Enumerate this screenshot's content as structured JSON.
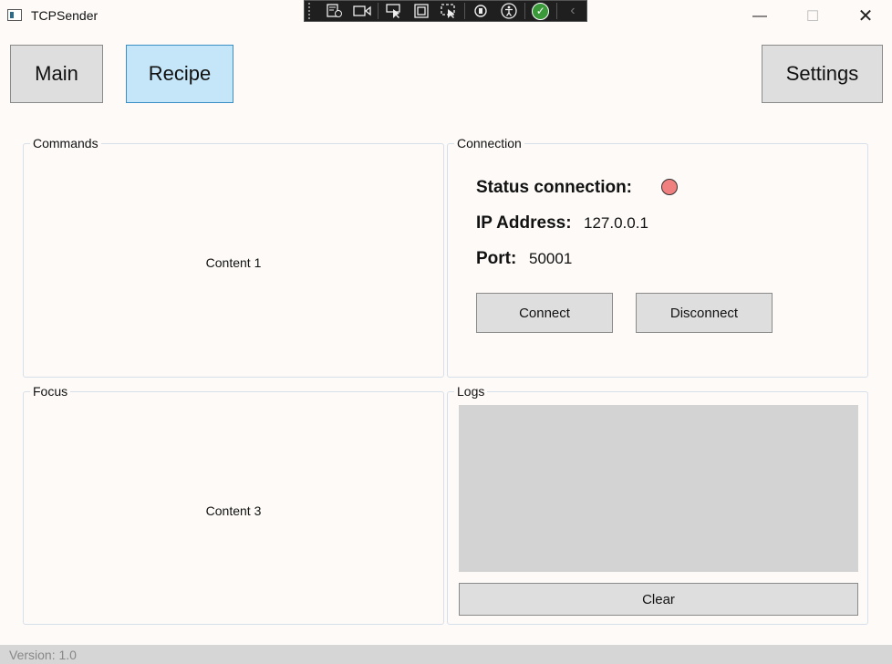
{
  "window": {
    "title": "TCPSender",
    "minimize_glyph": "—",
    "maximize_glyph": "☐",
    "close_glyph": "✕"
  },
  "debug_toolbar": {
    "icons": [
      "live-visual-tree-icon",
      "video-icon",
      "select-element-icon",
      "layout-adorner-icon",
      "track-focus-icon",
      "hot-reload-icon",
      "accessibility-icon",
      "checkmark-icon",
      "collapse-icon"
    ]
  },
  "nav": {
    "main_label": "Main",
    "recipe_label": "Recipe",
    "settings_label": "Settings",
    "active": "Recipe"
  },
  "commands": {
    "title": "Commands",
    "content": "Content 1"
  },
  "connection": {
    "title": "Connection",
    "status_label": "Status connection:",
    "status_color": "#f08080",
    "ip_label": "IP Address:",
    "ip_value": "127.0.0.1",
    "port_label": "Port:",
    "port_value": "50001",
    "connect_label": "Connect",
    "disconnect_label": "Disconnect"
  },
  "focus": {
    "title": "Focus",
    "content": "Content 3"
  },
  "logs": {
    "title": "Logs",
    "clear_label": "Clear"
  },
  "statusbar": {
    "version": "Version: 1.0"
  },
  "colors": {
    "accent": "#c5e6f8",
    "accent_border": "#3a8fc4",
    "button_bg": "#dedede",
    "log_bg": "#d3d3d3"
  }
}
